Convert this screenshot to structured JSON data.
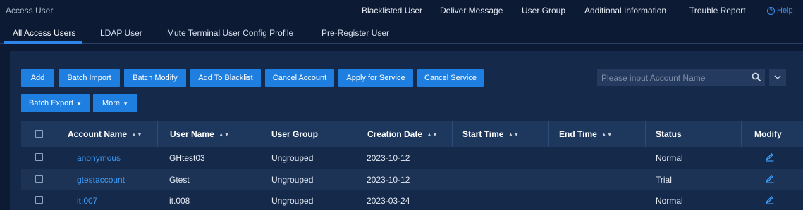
{
  "header": {
    "title": "Access User",
    "nav": [
      "Blacklisted User",
      "Deliver Message",
      "User Group",
      "Additional Information",
      "Trouble Report"
    ],
    "help_label": "Help"
  },
  "tabs": [
    "All Access Users",
    "LDAP User",
    "Mute Terminal User Config Profile",
    "Pre-Register User"
  ],
  "active_tab": "All Access Users",
  "toolbar": {
    "row1": [
      "Add",
      "Batch Import",
      "Batch Modify",
      "Add To Blacklist",
      "Cancel Account",
      "Apply for Service",
      "Cancel Service"
    ],
    "row2": [
      "Batch Export",
      "More"
    ],
    "search_placeholder": "Please input Account Name"
  },
  "table": {
    "columns": [
      "Account Name",
      "User Name",
      "User Group",
      "Creation Date",
      "Start Time",
      "End Time",
      "Status",
      "Modify"
    ],
    "rows": [
      {
        "account": "anonymous",
        "user": "GHtest03",
        "group": "Ungrouped",
        "created": "2023-10-12",
        "start": "",
        "end": "",
        "status": "Normal"
      },
      {
        "account": "gtestaccount",
        "user": "Gtest",
        "group": "Ungrouped",
        "created": "2023-10-12",
        "start": "",
        "end": "",
        "status": "Trial"
      },
      {
        "account": "it.007",
        "user": "it.008",
        "group": "Ungrouped",
        "created": "2023-03-24",
        "start": "",
        "end": "",
        "status": "Normal"
      }
    ]
  },
  "colors": {
    "background": "#0d1a33",
    "panel": "#15294a",
    "accent": "#1f7fe0",
    "link": "#3d9bf5"
  },
  "icons": {
    "help": "help-circle-icon",
    "search": "search-icon",
    "dropdown": "chevron-down-icon",
    "sort": "sort-arrows-icon",
    "modify": "edit-pencil-icon"
  }
}
